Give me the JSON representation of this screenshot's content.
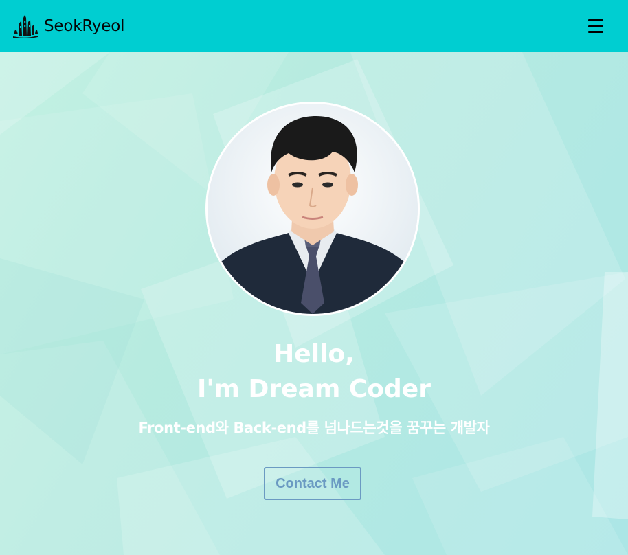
{
  "navbar": {
    "logo_icon": "city-skyline-logo-icon",
    "logo_text": "SeokRyeol",
    "menu_icon": "hamburger-menu-icon",
    "background_color": "#00ced1"
  },
  "home": {
    "avatar_alt": "profile-photo",
    "title_line1": "Hello,",
    "title_line2": "I'm Dream Coder",
    "description": "Front-end와 Back-end를 넘나드는것을 꿈꾸는 개발자",
    "contact_button_label": "Contact Me",
    "accent_color": "#6b9ac2",
    "background_color": "#b7ebe0"
  }
}
